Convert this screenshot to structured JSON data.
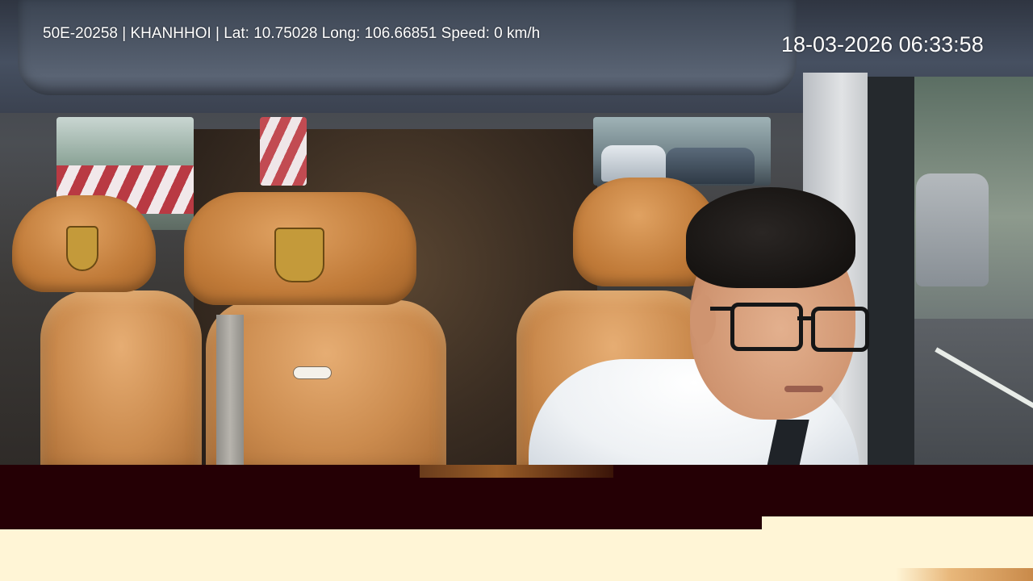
{
  "overlay": {
    "info": "50E-20258 | KHANHHOI | Lat: 10.75028 Long: 106.66851 Speed: 0 km/h",
    "timestamp": "18-03-2026 06:33:58"
  },
  "colors": {
    "text": "#ffffff",
    "seat_leather": "#cb8b4e",
    "glitch_dark": "#250005",
    "glitch_light": "#fff5d6"
  },
  "icons": [
    "dcar-crest-icon",
    "dcar-badge-icon"
  ]
}
